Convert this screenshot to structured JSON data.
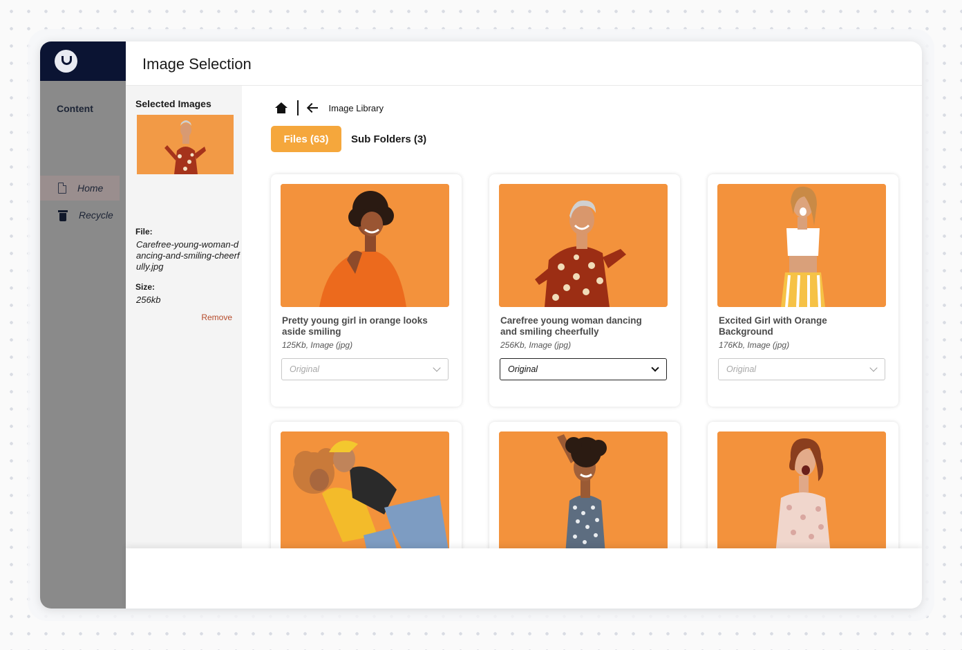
{
  "app": {
    "logo": "umbraco-logo",
    "title": "Image Selection"
  },
  "sidebar": {
    "section_title": "Content",
    "items": [
      {
        "label": "Home",
        "icon": "document-icon",
        "active": true
      },
      {
        "label": "Recycle",
        "icon": "trash-icon",
        "active": false
      }
    ]
  },
  "selected": {
    "title": "Selected Images",
    "file_label": "File:",
    "file_name": "Carefree-young-woman-dancing-and-smiling-cheerfully.jpg",
    "size_label": "Size:",
    "size_value": "256kb",
    "remove_label": "Remove"
  },
  "breadcrumb": {
    "current": "Image Library"
  },
  "tabs": {
    "files": "Files (63)",
    "subfolders": "Sub Folders (3)"
  },
  "cards": [
    {
      "title": "Pretty young girl in orange looks aside smiling",
      "meta": "125Kb, Image (jpg)",
      "select": "Original",
      "selected": false
    },
    {
      "title": "Carefree young woman dancing and smiling cheerfully",
      "meta": "256Kb, Image (jpg)",
      "select": "Original",
      "selected": true
    },
    {
      "title": "Excited Girl with Orange Background",
      "meta": "176Kb, Image (jpg)",
      "select": "Original",
      "selected": false
    },
    {
      "title": "",
      "meta": "",
      "select": "",
      "selected": false
    },
    {
      "title": "",
      "meta": "",
      "select": "",
      "selected": false
    },
    {
      "title": "",
      "meta": "",
      "select": "",
      "selected": false
    }
  ],
  "colors": {
    "accent": "#f5a73c",
    "photo_bg": "#f3953e",
    "sidebar_dark": "#0b1433",
    "sidebar": "#8a8a8a",
    "remove": "#b54a2a"
  }
}
